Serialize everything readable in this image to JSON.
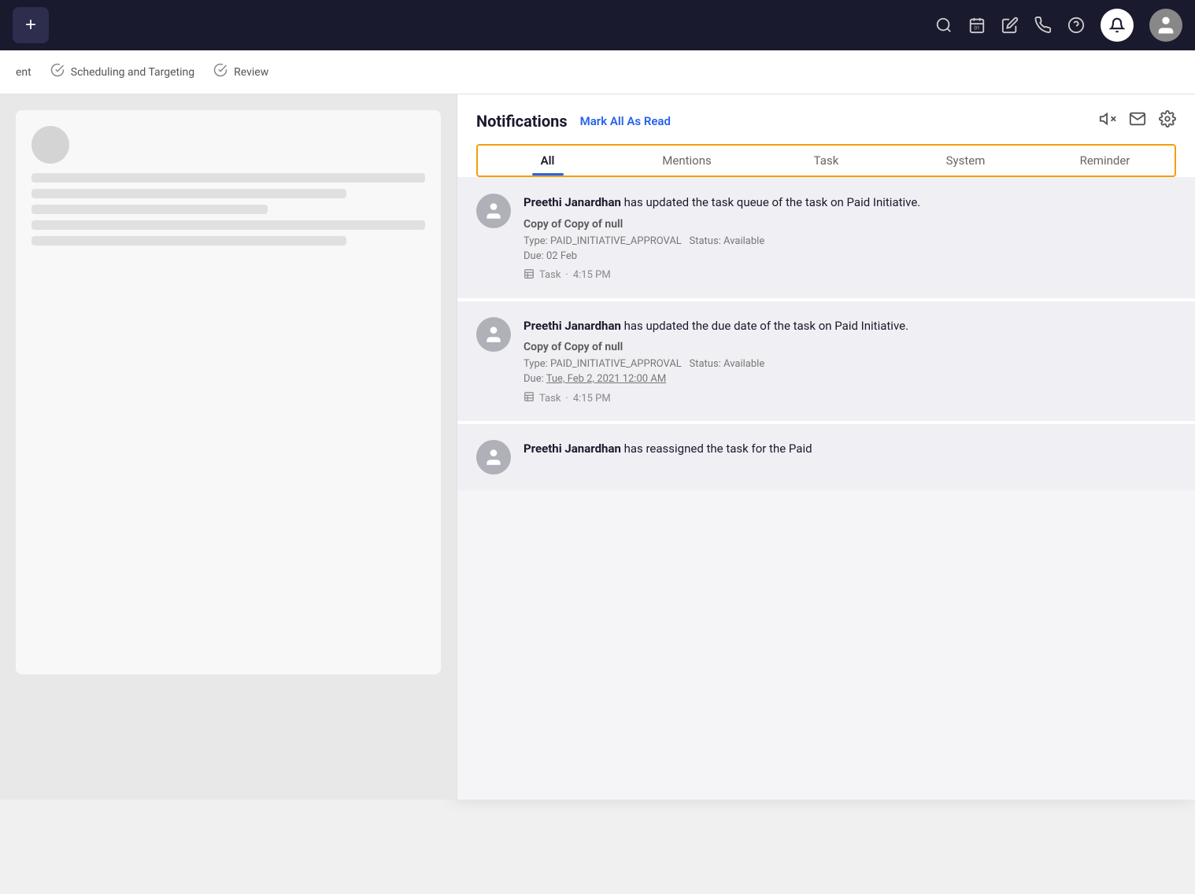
{
  "topNav": {
    "addLabel": "+",
    "icons": {
      "search": "🔍",
      "calendar": "📅",
      "edit": "✏️",
      "phone": "📞",
      "help": "❓",
      "bell": "🔔",
      "avatar": "👤"
    },
    "calendarDate": "01"
  },
  "breadcrumb": {
    "items": [
      {
        "label": "ent",
        "hasCheck": false
      },
      {
        "label": "Scheduling and Targeting",
        "hasCheck": true
      },
      {
        "label": "Review",
        "hasCheck": true
      }
    ]
  },
  "notifications": {
    "title": "Notifications",
    "markAllRead": "Mark All As Read",
    "icons": {
      "mute": "🔇",
      "email": "✉",
      "settings": "⚙"
    },
    "tabs": [
      {
        "label": "All",
        "active": true
      },
      {
        "label": "Mentions",
        "active": false
      },
      {
        "label": "Task",
        "active": false
      },
      {
        "label": "System",
        "active": false
      },
      {
        "label": "Reminder",
        "active": false
      }
    ],
    "items": [
      {
        "id": 1,
        "user": "Preethi Janardhan",
        "action": " has updated the task queue of the task on Paid Initiative.",
        "subtitle": "Copy of Copy of null",
        "type": "PAID_INITIATIVE_APPROVAL",
        "status": "Available",
        "due": "02 Feb",
        "dueLabel": "Due:",
        "category": "Task",
        "time": "4:15 PM"
      },
      {
        "id": 2,
        "user": "Preethi Janardhan",
        "action": " has updated the due date of the task on Paid Initiative.",
        "subtitle": "Copy of Copy of null",
        "type": "PAID_INITIATIVE_APPROVAL",
        "status": "Available",
        "due": "Tue, Feb 2, 2021 12:00 AM",
        "dueLabel": "Due:",
        "dueUnderline": true,
        "category": "Task",
        "time": "4:15 PM"
      },
      {
        "id": 3,
        "user": "Preethi Janardhan",
        "action": " has reassigned the task for the Paid",
        "subtitle": "",
        "type": "",
        "status": "",
        "due": "",
        "category": "",
        "time": "",
        "partial": true
      }
    ]
  }
}
